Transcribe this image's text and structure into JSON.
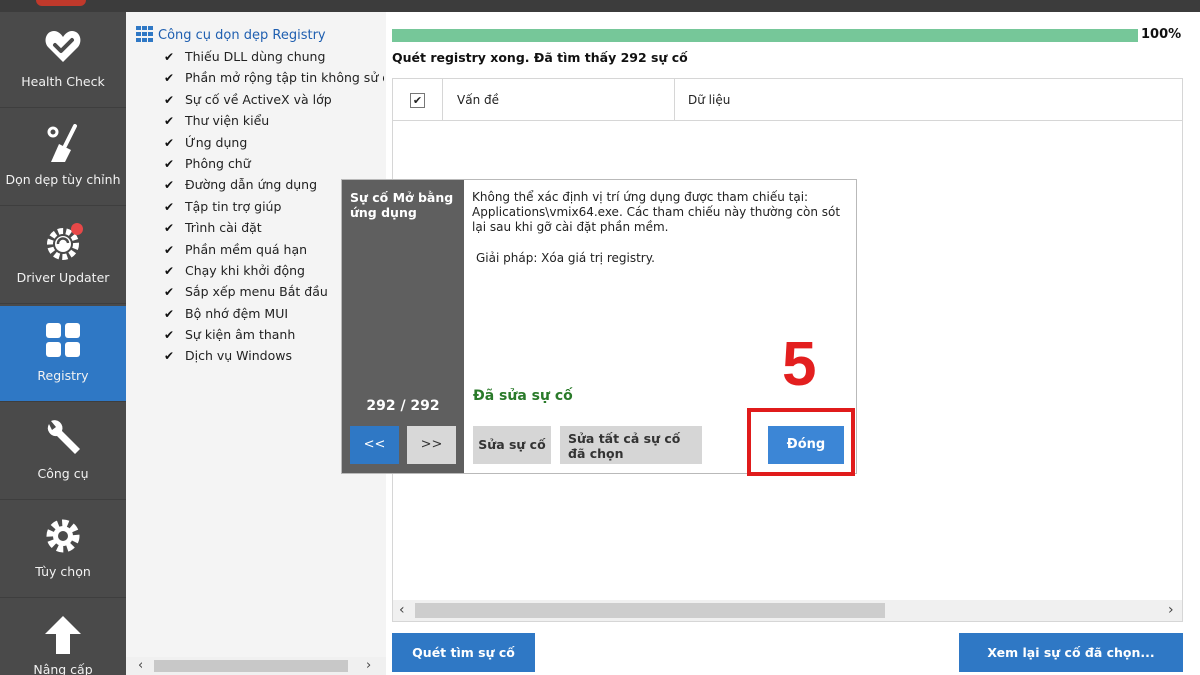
{
  "nav": {
    "items": [
      {
        "label": "Health Check",
        "icon": "heart-check-icon"
      },
      {
        "label": "Dọn dẹp tùy chỉnh",
        "icon": "broom-icon"
      },
      {
        "label": "Driver Updater",
        "icon": "gear-refresh-icon"
      },
      {
        "label": "Registry",
        "icon": "grid-icon"
      },
      {
        "label": "Công cụ",
        "icon": "wrench-icon"
      },
      {
        "label": "Tùy chọn",
        "icon": "gear-icon"
      },
      {
        "label": "Nâng cấp",
        "icon": "arrow-up-icon"
      }
    ],
    "active": "Registry"
  },
  "tree": {
    "title": "Công cụ dọn dẹp Registry",
    "items": [
      "Thiếu DLL dùng chung",
      "Phần mở rộng tập tin không sử dụ",
      "Sự cố về ActiveX và lớp",
      "Thư viện kiểu",
      "Ứng dụng",
      "Phông chữ",
      "Đường dẫn ứng dụng",
      "Tập tin trợ giúp",
      "Trình cài đặt",
      "Phần mềm quá hạn",
      "Chạy khi khởi động",
      "Sắp xếp menu Bắt đầu",
      "Bộ nhớ đệm MUI",
      "Sự kiện âm thanh",
      "Dịch vụ Windows"
    ]
  },
  "main": {
    "progress_percent": 100,
    "progress_label": "100%",
    "status": "Quét registry xong. Đã tìm thấy 292 sự cố",
    "columns": [
      "Vấn đề",
      "Dữ liệu"
    ],
    "scan_button": "Quét tìm sự cố",
    "review_button": "Xem lại sự cố đã chọn..."
  },
  "popup": {
    "title": "Sự cố Mở bằng ứng dụng",
    "counter": "292 / 292",
    "prev": "<<",
    "next": ">>",
    "description": "Không thể xác định vị trí ứng dụng được tham chiếu tại: Applications\\vmix64.exe. Các tham chiếu này thường còn sót lại sau khi gỡ cài đặt phần mềm.",
    "solution": "Giải pháp: Xóa giá trị registry.",
    "fixed_label": "Đã sửa sự cố",
    "fix_button": "Sửa sự cố",
    "fix_all_button": "Sửa tất cả sự cố đã chọn",
    "close_button": "Đóng"
  },
  "annotation": {
    "step": "5",
    "color": "#e01b1b"
  },
  "colors": {
    "nav_bg": "#4a4a4a",
    "accent": "#2f78c5",
    "progress": "#76c799",
    "fixed_green": "#2a7a2a"
  }
}
